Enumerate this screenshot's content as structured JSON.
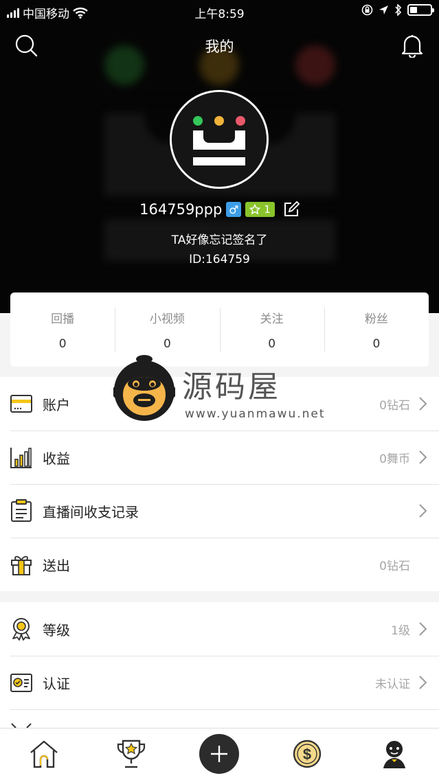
{
  "status_bar": {
    "carrier": "中国移动",
    "time": "上午8:59"
  },
  "nav": {
    "title": "我的"
  },
  "profile": {
    "username": "164759ppp",
    "gender_symbol": "♂",
    "level_badge": "1",
    "signature": "TA好像忘记签名了",
    "user_id": "ID:164759"
  },
  "stats": [
    {
      "label": "回播",
      "value": "0"
    },
    {
      "label": "小视频",
      "value": "0"
    },
    {
      "label": "关注",
      "value": "0"
    },
    {
      "label": "粉丝",
      "value": "0"
    }
  ],
  "menu_group_1": [
    {
      "label": "账户",
      "value": "0钻石",
      "icon": "wallet-icon",
      "chevron": true
    },
    {
      "label": "收益",
      "value": "0舞币",
      "icon": "bar-chart-icon",
      "chevron": true
    },
    {
      "label": "直播间收支记录",
      "value": "",
      "icon": "clipboard-icon",
      "chevron": true
    },
    {
      "label": "送出",
      "value": "0钻石",
      "icon": "gift-icon",
      "chevron": false
    }
  ],
  "menu_group_2": [
    {
      "label": "等级",
      "value": "1级",
      "icon": "medal-icon",
      "chevron": true
    },
    {
      "label": "认证",
      "value": "未认证",
      "icon": "id-card-icon",
      "chevron": true
    }
  ],
  "watermark": {
    "text": "源码屋",
    "url": "www.yuanmawu.net"
  },
  "tabbar": [
    "home-icon",
    "trophy-icon",
    "plus-icon",
    "coin-icon",
    "profile-icon"
  ],
  "colors": {
    "accent": "#f5c518",
    "gender": "#3d9ee8",
    "level": "#8ac32b",
    "text_muted": "#a6a6a6"
  }
}
